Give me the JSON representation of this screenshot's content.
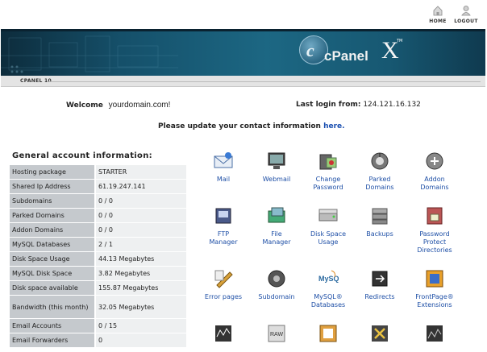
{
  "topnav": {
    "home_label": "HOME",
    "logout_label": "LOGOUT"
  },
  "banner": {
    "logo_glyph": "c",
    "logo_text": "cPanel",
    "logo_x": "X",
    "logo_tm": "TM"
  },
  "subbar": {
    "crumb": "CPANEL 10"
  },
  "welcome": {
    "label": "Welcome",
    "domain": "yourdomain.com!"
  },
  "last_login": {
    "label": "Last login from:",
    "ip": "124.121.16.132"
  },
  "update_notice": {
    "text": "Please update your contact information ",
    "link": "here."
  },
  "account_info": {
    "heading": "General account information:",
    "rows": [
      {
        "key": "Hosting package",
        "value": "STARTER"
      },
      {
        "key": "Shared Ip Address",
        "value": "61.19.247.141"
      },
      {
        "key": "Subdomains",
        "value": "0 / 0"
      },
      {
        "key": "Parked Domains",
        "value": "0 / 0"
      },
      {
        "key": "Addon Domains",
        "value": "0 / 0"
      },
      {
        "key": "MySQL Databases",
        "value": "2 / 1"
      },
      {
        "key": "Disk Space Usage",
        "value": "44.13 Megabytes"
      },
      {
        "key": "MySQL Disk Space",
        "value": "3.82 Megabytes"
      },
      {
        "key": "Disk space available",
        "value": "155.87 Megabytes"
      },
      {
        "key": "Bandwidth (this month)",
        "value": "32.05 Megabytes"
      },
      {
        "key": "Email Accounts",
        "value": "0 / 15"
      },
      {
        "key": "Email Forwarders",
        "value": "0"
      }
    ]
  },
  "icons": [
    {
      "line1": "Mail",
      "line2": "",
      "line3": "",
      "icon": "mail-icon"
    },
    {
      "line1": "Webmail",
      "line2": "",
      "line3": "",
      "icon": "webmail-icon"
    },
    {
      "line1": "Change",
      "line2": "Password",
      "line3": "",
      "icon": "change-password-icon"
    },
    {
      "line1": "Parked",
      "line2": "Domains",
      "line3": "",
      "icon": "parked-domains-icon"
    },
    {
      "line1": "Addon",
      "line2": "Domains",
      "line3": "",
      "icon": "addon-domains-icon"
    },
    {
      "line1": "FTP",
      "line2": "Manager",
      "line3": "",
      "icon": "ftp-manager-icon"
    },
    {
      "line1": "File",
      "line2": "Manager",
      "line3": "",
      "icon": "file-manager-icon"
    },
    {
      "line1": "Disk Space",
      "line2": "Usage",
      "line3": "",
      "icon": "disk-space-icon"
    },
    {
      "line1": "Backups",
      "line2": "",
      "line3": "",
      "icon": "backups-icon"
    },
    {
      "line1": "Password",
      "line2": "Protect",
      "line3": "Directories",
      "icon": "password-protect-icon"
    },
    {
      "line1": "Error pages",
      "line2": "",
      "line3": "",
      "icon": "error-pages-icon"
    },
    {
      "line1": "Subdomain",
      "line2": "",
      "line3": "",
      "icon": "subdomain-icon"
    },
    {
      "line1": "MySQL®",
      "line2": "Databases",
      "line3": "",
      "icon": "mysql-icon"
    },
    {
      "line1": "Redirects",
      "line2": "",
      "line3": "",
      "icon": "redirects-icon"
    },
    {
      "line1": "FrontPage®",
      "line2": "Extensions",
      "line3": "",
      "icon": "frontpage-icon"
    },
    {
      "line1": "",
      "line2": "",
      "line3": "",
      "icon": "stats-icon"
    },
    {
      "line1": "",
      "line2": "",
      "line3": "",
      "icon": "raw-log-icon"
    },
    {
      "line1": "",
      "line2": "",
      "line3": "",
      "icon": "log-archive-icon"
    },
    {
      "line1": "",
      "line2": "",
      "line3": "",
      "icon": "error-log-icon"
    },
    {
      "line1": "",
      "line2": "",
      "line3": "",
      "icon": "webalizer-icon"
    }
  ],
  "mysql_logo_text": "MySQL"
}
